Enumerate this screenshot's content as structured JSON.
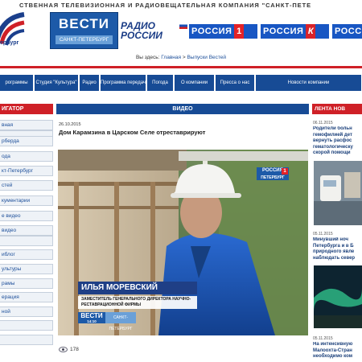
{
  "header": {
    "company_line": "СТВЕННАЯ ТЕЛЕВИЗИОННАЯ И РАДИОВЕЩАТЕЛЬНАЯ КОМПАНИЯ \"САНКТ-ПЕТЕ",
    "logo_city": "ербург",
    "vesti_title": "ВЕСТИ",
    "vesti_sub": "САНКТ-ПЕТЕРБУРГ",
    "radio_line1": "РАДИО",
    "radio_line2": "РОССИИ",
    "channels": [
      {
        "label": "РОССИЯ",
        "badge": "1"
      },
      {
        "label": "РОССИЯ",
        "badge": "К"
      },
      {
        "label": "РОСС",
        "badge": ""
      }
    ],
    "breadcrumb_prefix": "Вы здесь:",
    "breadcrumb_home": "Главная",
    "breadcrumb_sep": ">",
    "breadcrumb_current": "Выпуски Вестей"
  },
  "nav": {
    "items": [
      "рограммы",
      "Студия \"Культура\"",
      "Радио",
      "Программа передач",
      "Погода",
      "О компании",
      "Пресса о нас",
      "Новости компании"
    ]
  },
  "sidebar": {
    "title": "ИГАТОР",
    "items": [
      "вная",
      "",
      "рберда",
      "ода",
      "кт-Петербург",
      "стей",
      "кументарии",
      "е видео",
      "видео",
      "",
      "иблог",
      "ультуры",
      "рамы",
      "ерация",
      "ной",
      "",
      ""
    ]
  },
  "main": {
    "section_title": "ВИДЕО",
    "date": "26.10.2015",
    "title": "Дом Карамзина в Царском Селе отреставрируют",
    "bug_text": "РОССИЯ",
    "bug_num": "1",
    "bug_sub": "ПЕТЕРБУРГ",
    "caption_name": "ИЛЬЯ МОРЕВСКИЙ",
    "caption_role": "ЗАМЕСТИТЕЛЬ ГЕНЕРАЛЬНОГО ДИРЕКТОРА НАУЧНО-РЕСТАВРАЦИОННОЙ ФИРМЫ",
    "caption_vesti": "ВЕСТИ",
    "caption_vesti_sub": "14:10",
    "caption_city": "САНКТ-ПЕТЕРБУРГ",
    "views": "178"
  },
  "lenta": {
    "title": "ЛЕНТА НОВ",
    "news": [
      {
        "date": "06.11.2015",
        "text": "Родители больн гемофилией дет вернуть расфос гематологическу скорой помощи"
      },
      {
        "date": "05.11.2015",
        "text": "Минувший ноч Петербурга и в Б природного явле наблюдать север"
      },
      {
        "date": "05.11.2015",
        "text": "На интенсивную Малоохта-Стран необходимо ком"
      }
    ]
  },
  "colors": {
    "brand_blue": "#174b95",
    "brand_red": "#cf2027",
    "channel_blue": "#1856c3"
  }
}
